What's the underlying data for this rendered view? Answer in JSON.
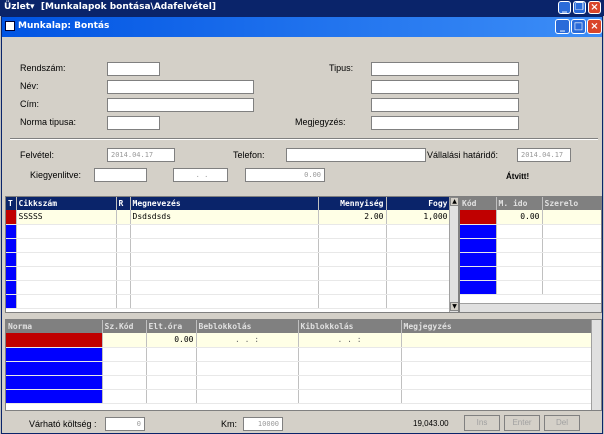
{
  "app": {
    "title": "Üzlet",
    "window_title": "[Munkalapok bontása\\Adafelvétel]"
  },
  "dialog": {
    "title": "Munkalap: Bontás"
  },
  "form": {
    "rendszam_label": "Rendszám:",
    "rendszam": "",
    "nev_label": "Név:",
    "nev": "",
    "cim_label": "Cím:",
    "cim": "",
    "norma_label": "Norma tipusa:",
    "norma": "",
    "tipus_label": "Tipus:",
    "tipus": "",
    "megj_label": "Megjegyzés:",
    "megj": ""
  },
  "info": {
    "felvetel_label": "Felvétel:",
    "felvetel": "2014.04.17",
    "telefon_label": "Telefon:",
    "telefon": "",
    "hatarido_label": "Vállalási határidő:",
    "hatarido": "2014.04.17",
    "kiegyenlitve_label": "Kiegyenlitve:",
    "kiegyenlitve_date": ". .",
    "kiegyenlitve_amount": "0.00",
    "atvitt_label": "Átvitt!"
  },
  "parts_grid": {
    "headers": [
      "T",
      "Cikkszám",
      "R",
      "Megnevezés",
      "Mennyiség",
      "Fogy"
    ],
    "rows": [
      [
        "",
        "SSSSS",
        "",
        "Dsdsdsds",
        "2.00",
        "1,000"
      ]
    ],
    "empty_rows": 6
  },
  "side_grid": {
    "headers": [
      "Kód",
      "M. ido",
      "Szerelo"
    ],
    "rows": [
      [
        "",
        "0.00",
        ""
      ]
    ],
    "empty_rows": 6
  },
  "norma_grid": {
    "headers": [
      "Norma",
      "Sz.Kód",
      "Elt.óra",
      "Beblokkolás",
      "Kiblokkolás",
      "Megjegyzés"
    ],
    "rows": [
      [
        "",
        "",
        "0.00",
        ". . :",
        ". . :",
        ""
      ]
    ],
    "empty_rows": 4
  },
  "footer": {
    "varhato_label": "Várható költség :",
    "varhato": "0",
    "km_label": "Km:",
    "km": "10000",
    "total": "19,043.00",
    "ins": "Ins",
    "enter": "Enter",
    "del": "Del"
  }
}
